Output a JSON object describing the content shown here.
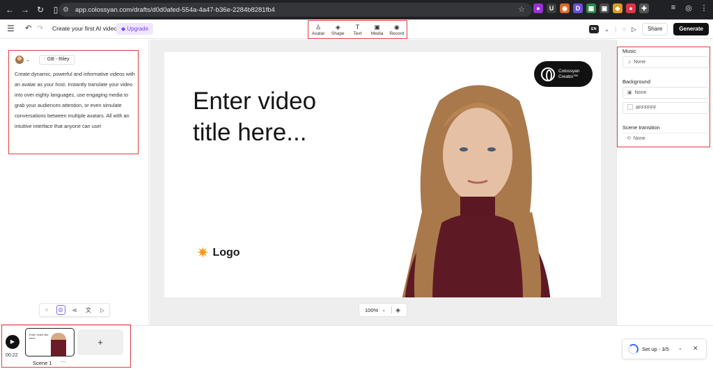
{
  "browser": {
    "url": "app.colossyan.com/drafts/d0d0afed-554a-4a47-b36e-2284b8281fb4"
  },
  "toolbar": {
    "title": "Create your first AI video",
    "upgrade_label": "Upgrade",
    "tools": [
      {
        "label": "Avatar",
        "icon": "avatar-icon"
      },
      {
        "label": "Shape",
        "icon": "shape-icon"
      },
      {
        "label": "Text",
        "icon": "text-icon"
      },
      {
        "label": "Media",
        "icon": "media-icon"
      },
      {
        "label": "Record",
        "icon": "record-icon"
      }
    ],
    "language": "EN",
    "share_label": "Share",
    "generate_label": "Generate"
  },
  "script_panel": {
    "voice": "GB - Riley",
    "text": "Create dynamic, powerful and informative videos with an avatar as your host. Instantly translate your video into over eighty languages, use engaging media to grab your audiences attention, or even simulate conversations between multiple avatars. All with an intuitive interface that anyone can use!"
  },
  "slide": {
    "title": "Enter video title here...",
    "logo_text": "Logo",
    "brand_line1": "Colossyan",
    "brand_line2": "Creator™"
  },
  "canvas": {
    "zoom": "100%"
  },
  "properties": {
    "music_label": "Music",
    "music_value": "None",
    "background_label": "Background",
    "background_value": "None",
    "background_color": "#FFFFFF",
    "transition_label": "Scene transition",
    "transition_value": "None"
  },
  "timeline": {
    "time": "00:22",
    "scene_label": "Scene 1",
    "thumb_title": "Enter video title here...",
    "add_label": "+"
  },
  "setup": {
    "label": "Set up - 3/5"
  }
}
